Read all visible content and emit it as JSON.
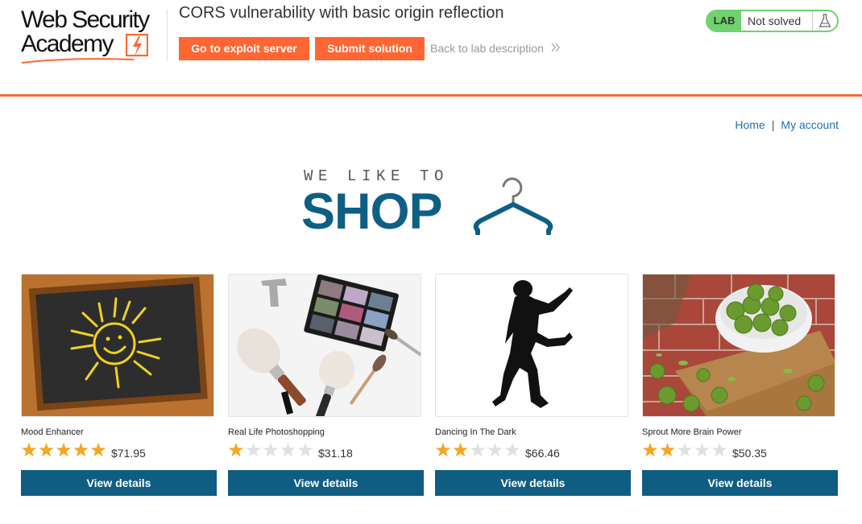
{
  "logo": {
    "line1": "Web Security",
    "line2": "Academy"
  },
  "lab": {
    "title": "CORS vulnerability with basic origin reflection",
    "exploit_button": "Go to exploit server",
    "submit_button": "Submit solution",
    "back_link": "Back to lab description",
    "badge": "LAB",
    "status": "Not solved"
  },
  "nav": {
    "home": "Home",
    "separator": "|",
    "my_account": "My account"
  },
  "hero": {
    "tagline": "WE LIKE TO",
    "headline": "SHOP"
  },
  "colors": {
    "accent": "#ff6633",
    "brand_blue": "#0f5d83",
    "link": "#1a6fb5",
    "status_green": "#70d16d",
    "star_filled": "#f5a623",
    "star_empty": "#e0e0e0"
  },
  "products": [
    {
      "name": "Mood Enhancer",
      "rating": 5,
      "max_rating": 5,
      "price": "$71.95",
      "button": "View details",
      "image": "sun-chalkboard"
    },
    {
      "name": "Real Life Photoshopping",
      "rating": 1,
      "max_rating": 5,
      "price": "$31.18",
      "button": "View details",
      "image": "makeup-palette"
    },
    {
      "name": "Dancing In The Dark",
      "rating": 2,
      "max_rating": 5,
      "price": "$66.46",
      "button": "View details",
      "image": "dancer-silhouette"
    },
    {
      "name": "Sprout More Brain Power",
      "rating": 2,
      "max_rating": 5,
      "price": "$50.35",
      "button": "View details",
      "image": "brussels-sprouts"
    }
  ]
}
